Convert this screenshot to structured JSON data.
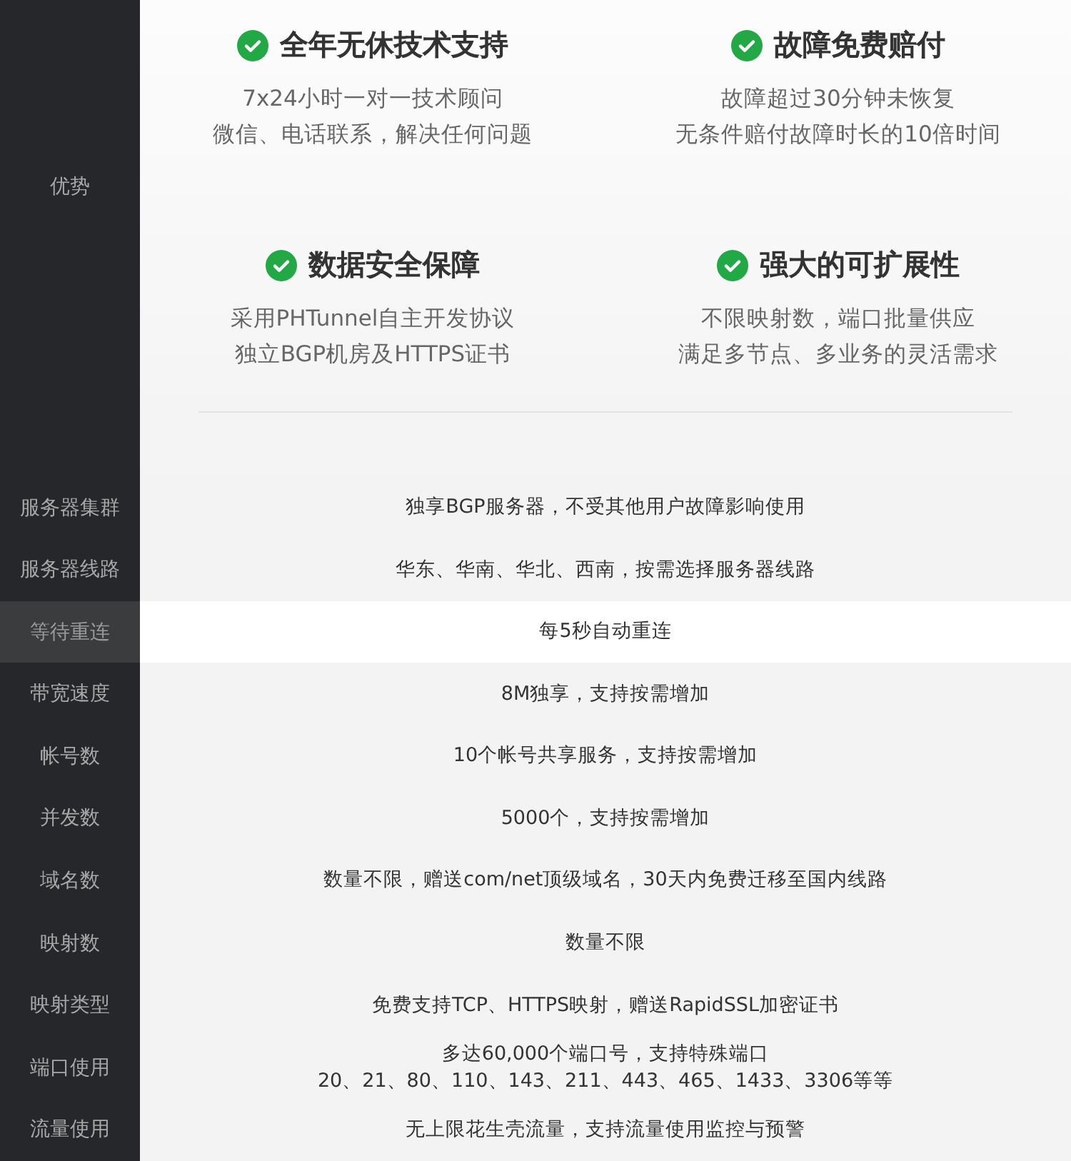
{
  "advantages": {
    "label": "优势",
    "features": [
      {
        "title": "全年无休技术支持",
        "lines": [
          "7x24小时一对一技术顾问",
          "微信、电话联系，解决任何问题"
        ]
      },
      {
        "title": "故障免费赔付",
        "lines": [
          "故障超过30分钟未恢复",
          "无条件赔付故障时长的10倍时间"
        ]
      },
      {
        "title": "数据安全保障",
        "lines": [
          "采用PHTunnel自主开发协议",
          "独立BGP机房及HTTPS证书"
        ]
      },
      {
        "title": "强大的可扩展性",
        "lines": [
          "不限映射数，端口批量供应",
          "满足多节点、多业务的灵活需求"
        ]
      }
    ]
  },
  "specs": [
    {
      "label": "服务器集群",
      "lines": [
        "独享BGP服务器，不受其他用户故障影响使用"
      ],
      "selected": false
    },
    {
      "label": "服务器线路",
      "lines": [
        "华东、华南、华北、西南，按需选择服务器线路"
      ],
      "selected": false
    },
    {
      "label": "等待重连",
      "lines": [
        "每5秒自动重连"
      ],
      "selected": true
    },
    {
      "label": "带宽速度",
      "lines": [
        "8M独享，支持按需增加"
      ],
      "selected": false
    },
    {
      "label": "帐号数",
      "lines": [
        "10个帐号共享服务，支持按需增加"
      ],
      "selected": false
    },
    {
      "label": "并发数",
      "lines": [
        "5000个，支持按需增加"
      ],
      "selected": false
    },
    {
      "label": "域名数",
      "lines": [
        "数量不限，赠送com/net顶级域名，30天内免费迁移至国内线路"
      ],
      "selected": false
    },
    {
      "label": "映射数",
      "lines": [
        "数量不限"
      ],
      "selected": false
    },
    {
      "label": "映射类型",
      "lines": [
        "免费支持TCP、HTTPS映射，赠送RapidSSL加密证书"
      ],
      "selected": false
    },
    {
      "label": "端口使用",
      "lines": [
        "多达60,000个端口号，支持特殊端口",
        "20、21、80、110、143、211、443、465、1433、3306等等"
      ],
      "selected": false
    },
    {
      "label": "流量使用",
      "lines": [
        "无上限花生壳流量，支持流量使用监控与预警"
      ],
      "selected": false
    }
  ]
}
